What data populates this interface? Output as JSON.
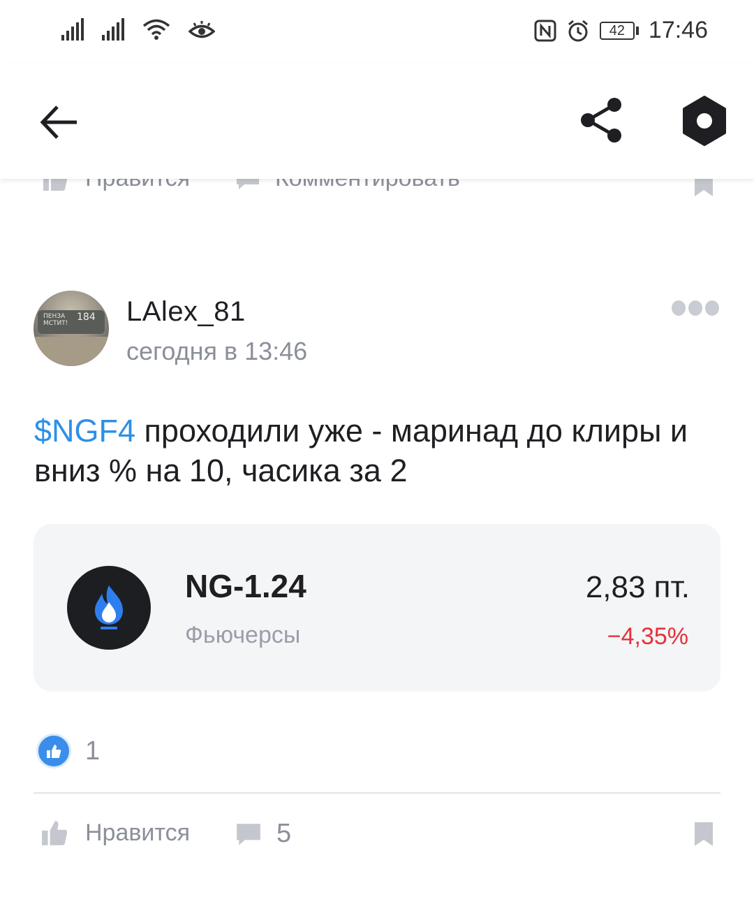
{
  "status_bar": {
    "time": "17:46",
    "battery": "42",
    "nfc_icon": "nfc-icon",
    "alarm_icon": "alarm-icon",
    "wifi_icon": "wifi-icon",
    "eye_icon": "eye-comfort-icon"
  },
  "app_bar": {
    "back_icon": "arrow-left-icon",
    "share_icon": "share-icon",
    "logo_icon": "hexagon-icon"
  },
  "previous_post": {
    "like_label": "Нравится",
    "comment_label": "Комментировать"
  },
  "post": {
    "author": "LAlex_81",
    "time": "сегодня в 13:46",
    "ticker": "$NGF4",
    "text": " проходили уже - маринад до клиры и вниз % на 10, часика за 2",
    "instrument": {
      "name": "NG-1.24",
      "type": "Фьючерсы",
      "price": "2,83  пт.",
      "change": "−4,35%",
      "icon": "gas-flame-icon"
    },
    "reactions": {
      "count": "1",
      "icon": "thumbs-up-icon"
    },
    "actions": {
      "like_label": "Нравится",
      "comments_count": "5"
    }
  },
  "colors": {
    "link": "#2e8fe8",
    "negative": "#e5303a",
    "muted": "#8b8f99",
    "card_bg": "#f4f5f7"
  }
}
